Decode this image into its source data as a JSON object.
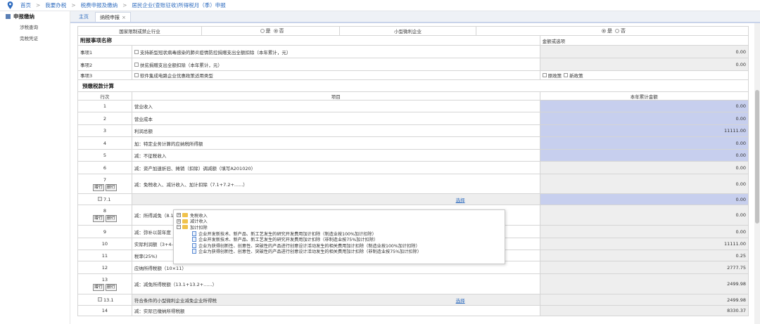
{
  "breadcrumb": [
    "首页",
    "我要办税",
    "税费申报及缴纳",
    "居民企业(查账征收)所得税月（季）申报"
  ],
  "sidebar": {
    "section": "申报缴纳",
    "items": [
      "涉税查询",
      "完税凭证"
    ]
  },
  "tabs": [
    "主页",
    "纳税申报"
  ],
  "tab_close": "×",
  "top_row": {
    "label1": "国家限制或禁止行业",
    "label2": "小型微利企业",
    "yes": "是",
    "no": "否"
  },
  "attached": {
    "title": "附报事项名称",
    "amount_header": "金额或选项",
    "items": [
      {
        "code": "事项1",
        "text": "支持新型冠状病毒感染的肺炎疫情防控捐赠支出全额扣除（本年累计，元）",
        "value": "0.00"
      },
      {
        "code": "事项2",
        "text": "扶贫捐赠支出全额扣除（本年累计，元）",
        "value": "0.00"
      },
      {
        "code": "事项3",
        "text": "软件集成电路企业优惠政策适用类型",
        "opt1": "原政策",
        "opt2": "新政策"
      }
    ]
  },
  "prepay": {
    "title": "预缴税款计算",
    "col_line": "行次",
    "col_item": "项目",
    "col_amount": "本年累计金额",
    "add_row": "增行",
    "del_row": "删行",
    "select_link": "选择",
    "rows": [
      {
        "no": "1",
        "item": "营业收入",
        "value": "0.00",
        "style": "blue"
      },
      {
        "no": "2",
        "item": "营业成本",
        "value": "0.00",
        "style": "blue"
      },
      {
        "no": "3",
        "item": "利润总额",
        "value": "11111.00",
        "style": "blue"
      },
      {
        "no": "4",
        "item": "加：特定业务计算的应纳税所得额",
        "value": "0.00",
        "style": "blue"
      },
      {
        "no": "5",
        "item": "减：不征税收入",
        "value": "0.00",
        "style": "blue"
      },
      {
        "no": "6",
        "item": "减：资产加速折旧、摊销（扣除）调减额（填写A201020）",
        "value": "0.00",
        "style": "grey"
      },
      {
        "no": "7",
        "item": "减：免税收入、减计收入、加计扣除（7.1+7.2+......）",
        "value": "0.00",
        "style": "grey",
        "buttons": true
      },
      {
        "no": "7.1",
        "item": "",
        "value": "0.00",
        "style": "blue",
        "sub": true
      },
      {
        "no": "8",
        "item": "减：所得减免（8.1",
        "value": "0.00",
        "style": "grey",
        "buttons": true
      },
      {
        "no": "9",
        "item": "减：弥补以前年度",
        "value": "0.00",
        "style": "grey"
      },
      {
        "no": "10",
        "item": "实际利润额（3+4-",
        "value": "11111.00",
        "style": "grey"
      },
      {
        "no": "11",
        "item": "税率(25%)",
        "value": "0.25",
        "style": "grey"
      },
      {
        "no": "12",
        "item": "应纳所得税额（10×11）",
        "value": "2777.75",
        "style": "grey"
      },
      {
        "no": "13",
        "item": "减：减免所得税额（13.1+13.2+......）",
        "value": "2499.98",
        "style": "grey",
        "buttons": true
      },
      {
        "no": "13.1",
        "item": "符合条件的小型微利企业减免企业所得税",
        "value": "2499.98",
        "style": "grey",
        "sub": true
      },
      {
        "no": "14",
        "item": "减：实际已缴纳所得税额",
        "value": "8330.37",
        "style": "grey"
      }
    ]
  },
  "popup": {
    "groups": [
      "免税收入",
      "减计收入",
      "加计扣除"
    ],
    "leaves": [
      "企业开发新技术、新产品、新工艺发生的研究开发费用加计扣除（制造业按100%加计扣除）",
      "企业开发新技术、新产品、新工艺发生的研究开发费用加计扣除（非制造业按75%加计扣除）",
      "企业为获得创新性、创意性、突破性的产品进行创意设计活动发生的相关费用加计扣除（制造业按100%加计扣除）",
      "企业为获得创新性、创意性、突破性的产品进行创意设计活动发生的相关费用加计扣除（非制造业按75%加计扣除）"
    ]
  },
  "colors": {
    "link": "#2f6cbf",
    "blue_cell": "#c7cfee",
    "grey_cell": "#eeeeee"
  }
}
